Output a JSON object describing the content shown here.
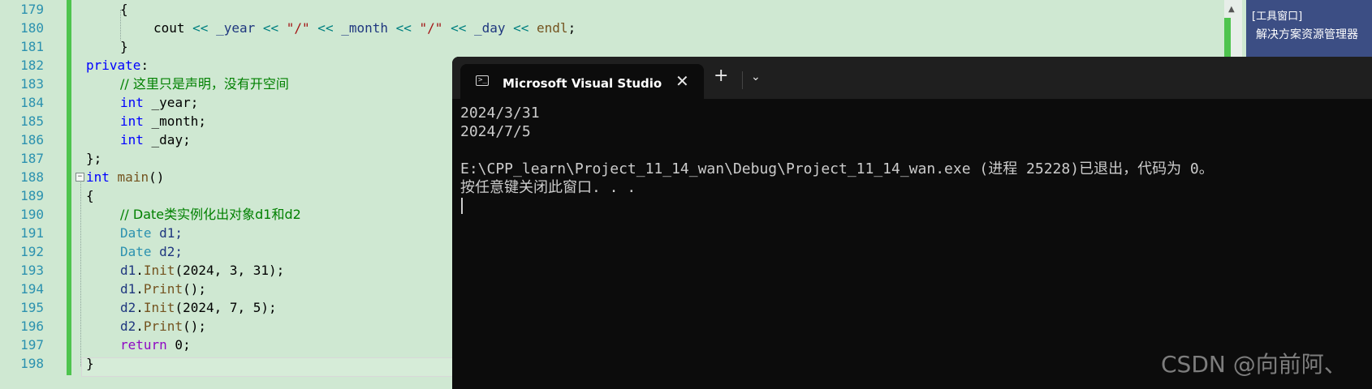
{
  "editor": {
    "line_numbers": [
      "179",
      "180",
      "181",
      "182",
      "183",
      "184",
      "185",
      "186",
      "187",
      "188",
      "189",
      "190",
      "191",
      "192",
      "193",
      "194",
      "195",
      "196",
      "197",
      "198"
    ],
    "fold_toggle": "−",
    "lines": {
      "l179": {
        "brace": "{"
      },
      "l180": {
        "cout": "cout",
        "op1": " << ",
        "v1": "_year",
        "op2": " << ",
        "s1": "\"/\"",
        "op3": " << ",
        "v2": "_month",
        "op4": " << ",
        "s2": "\"/\"",
        "op5": " << ",
        "v3": "_day",
        "op6": " << ",
        "endl": "endl",
        "semi": ";"
      },
      "l181": {
        "brace": "}"
      },
      "l182": {
        "kw": "private",
        "colon": ":"
      },
      "l183": {
        "comment": "// 这里只是声明，没有开空间"
      },
      "l184": {
        "kw": "int",
        "rest": " _year;"
      },
      "l185": {
        "kw": "int",
        "rest": " _month;"
      },
      "l186": {
        "kw": "int",
        "rest": " _day;"
      },
      "l187": {
        "text": "};"
      },
      "l188": {
        "kw": "int",
        "fn": "main",
        "rest": "()"
      },
      "l189": {
        "brace": "{"
      },
      "l190": {
        "comment": "// Date类实例化出对象d1和d2"
      },
      "l191": {
        "type": "Date",
        "rest": " d1;"
      },
      "l192": {
        "type": "Date",
        "rest": " d2;"
      },
      "l193": {
        "obj": "d1",
        "dot": ".",
        "fn": "Init",
        "rest": "(2024, 3, 31);"
      },
      "l194": {
        "obj": "d1",
        "dot": ".",
        "fn": "Print",
        "rest": "();"
      },
      "l195": {
        "obj": "d2",
        "dot": ".",
        "fn": "Init",
        "rest": "(2024, 7, 5);"
      },
      "l196": {
        "obj": "d2",
        "dot": ".",
        "fn": "Print",
        "rest": "();"
      },
      "l197": {
        "kw": "return",
        "rest": " 0;"
      },
      "l198": {
        "brace": "}"
      }
    }
  },
  "tool_window": {
    "caption": "[工具窗口]",
    "item": "解决方案资源管理器"
  },
  "terminal": {
    "tab_title": "Microsoft Visual Studio 调试控",
    "tab_icon": ">_",
    "close_label": "✕",
    "new_tab_label": "+",
    "dropdown_label": "⌄",
    "output_lines": [
      "2024/3/31",
      "2024/7/5",
      "",
      "E:\\CPP_learn\\Project_11_14_wan\\Debug\\Project_11_14_wan.exe (进程 25228)已退出，代码为 0。",
      "按任意键关闭此窗口. . ."
    ]
  },
  "watermark": "CSDN @向前阿、",
  "colors": {
    "editor_bg": "#cfe8d2",
    "keyword": "#0000ff",
    "type": "#2b91af",
    "comment": "#008000",
    "string": "#a31515",
    "terminal_bg": "#0c0c0c",
    "tool_window_bg": "#3c4e84"
  }
}
